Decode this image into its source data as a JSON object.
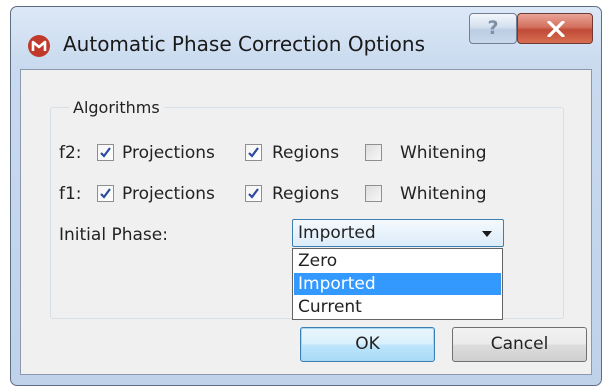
{
  "window": {
    "title": "Automatic Phase Correction Options",
    "help_glyph": "?",
    "close_glyph": "X"
  },
  "algorithms": {
    "group_title": "Algorithms",
    "rows": [
      {
        "label": "f2:",
        "options": [
          {
            "label": "Projections",
            "checked": true
          },
          {
            "label": "Regions",
            "checked": true
          },
          {
            "label": "Whitening",
            "checked": false
          }
        ]
      },
      {
        "label": "f1:",
        "options": [
          {
            "label": "Projections",
            "checked": true
          },
          {
            "label": "Regions",
            "checked": true
          },
          {
            "label": "Whitening",
            "checked": false
          }
        ]
      }
    ]
  },
  "initial_phase": {
    "label": "Initial Phase:",
    "selected": "Imported",
    "options": [
      "Zero",
      "Imported",
      "Current"
    ],
    "dropdown_open": true
  },
  "buttons": {
    "ok": "OK",
    "cancel": "Cancel"
  },
  "colors": {
    "selection": "#3399ff",
    "close_button": "#c04a36",
    "app_icon": "#c0392b"
  }
}
